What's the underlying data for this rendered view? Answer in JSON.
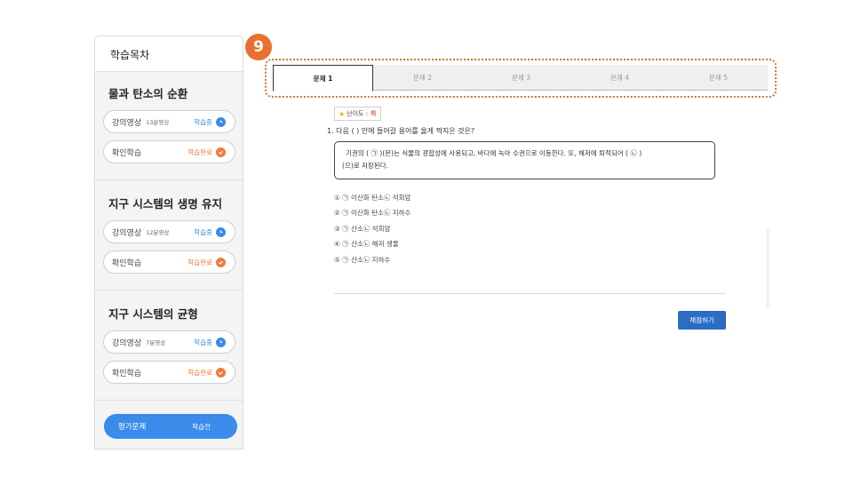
{
  "sidebar": {
    "title": "학습목차",
    "sections": [
      {
        "title": "물과 탄소의 순환",
        "video": {
          "label": "강의영상",
          "duration": "13분영상",
          "status": "학습중"
        },
        "check": {
          "label": "확인학습",
          "status": "학습완료"
        }
      },
      {
        "title": "지구 시스템의 생명 유지",
        "video": {
          "label": "강의영상",
          "duration": "12분영상",
          "status": "학습중"
        },
        "check": {
          "label": "확인학습",
          "status": "학습완료"
        }
      },
      {
        "title": "지구 시스템의 균형",
        "video": {
          "label": "강의영상",
          "duration": "7분영상",
          "status": "학습중"
        },
        "check": {
          "label": "확인학습",
          "status": "학습완료"
        }
      }
    ],
    "eval": {
      "label": "평가문제",
      "status": "학습전"
    }
  },
  "badge": "9",
  "tabs": [
    "문제 1",
    "문제 2",
    "문제 3",
    "문제 4",
    "문제 5"
  ],
  "question": {
    "difficulty_label": "난이도 :",
    "difficulty_value": "하",
    "prompt": "1. 다음 (    ) 안에 들어갈 용어를 옳게 짝지은 것은?",
    "passage_line1": "기권의 ( ㉠ )(은)는 식물의 광합성에 사용되고, 바다에 녹아 수권으로 이동한다. 또, 해저에 퇴적되어 ( ㉡ )",
    "passage_line2": "(으)로 저장된다.",
    "options": [
      "① ㉠ 이산화 탄소㉡ 석회암",
      "② ㉠ 이산화 탄소㉡ 지하수",
      "③ ㉠ 산소㉡ 석회암",
      "④ ㉠ 산소㉡ 해저 생물",
      "⑤ ㉠ 산소㉡ 지하수"
    ]
  },
  "grade_button": "채점하기",
  "colors": {
    "accent_blue": "#3b8beb",
    "accent_orange": "#f07b3f",
    "badge": "#e8712f",
    "grade": "#2b6cc4"
  }
}
